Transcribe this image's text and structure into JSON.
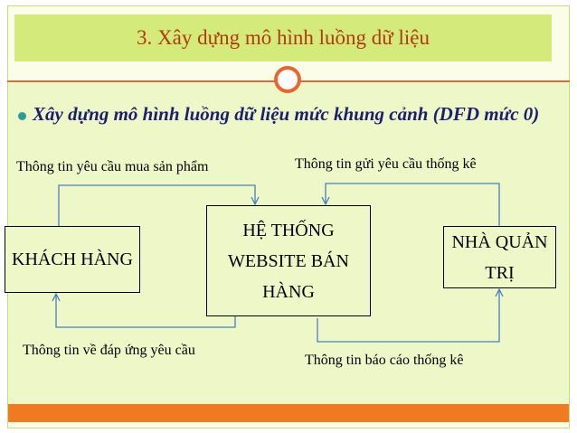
{
  "title": "3. Xây dựng mô hình luồng dữ liệu",
  "bullet": "Xây dựng mô hình luồng dữ liệu mức khung cảnh (DFD mức 0)",
  "nodes": {
    "customer": "KHÁCH HÀNG",
    "system": "HỆ THỐNG WEBSITE BÁN HÀNG",
    "admin": "NHÀ QUẢN TRỊ"
  },
  "flows": {
    "customer_to_system": "Thông tin yêu cầu mua sản phẩm",
    "admin_to_system": "Thông tin gửi yêu cầu thống kê",
    "system_to_customer": "Thông tin về đáp ứng yêu cầu",
    "system_to_admin": "Thông tin báo cáo thống kê"
  },
  "colors": {
    "title_band": "#d4ea7a",
    "title_text": "#b03a10",
    "accent": "#e6682e",
    "bullet_text": "#1e1e6e",
    "flow_line": "#4a7fc1",
    "background": "#eef7c8"
  }
}
